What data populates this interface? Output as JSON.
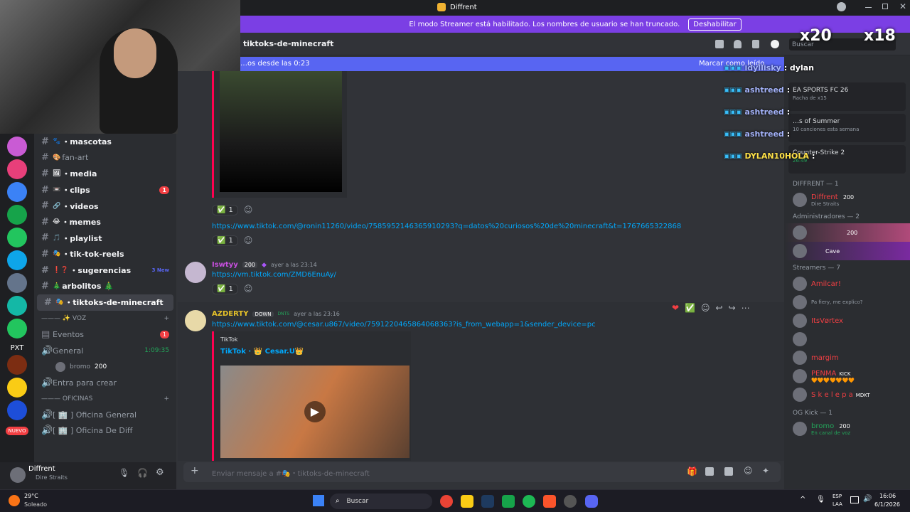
{
  "app": {
    "title": "Diffrent"
  },
  "banner": {
    "text": "El modo Streamer está habilitado. Los nombres de usuario se han truncado.",
    "button": "Deshabilitar"
  },
  "channel_header": {
    "name": "tiktoks-de-minecraft",
    "search_placeholder": "Buscar"
  },
  "new_bar": {
    "text": "…os desde las 0:23",
    "action": "Marcar como leído"
  },
  "channels": [
    {
      "emoji": "🐾",
      "name": "・mascotas",
      "unread": true
    },
    {
      "emoji": "🎨",
      "name": "fan-art",
      "unread": false
    },
    {
      "emoji": "🖼",
      "name": "・media",
      "unread": true
    },
    {
      "emoji": "📼",
      "name": "・clips",
      "unread": true,
      "badge": "1"
    },
    {
      "emoji": "🔗",
      "name": "・videos",
      "unread": true
    },
    {
      "emoji": "😂",
      "name": "・memes",
      "unread": true
    },
    {
      "emoji": "🎵",
      "name": "・playlist",
      "unread": true
    },
    {
      "emoji": "🎭",
      "name": "・tik-tok-reels",
      "unread": true
    },
    {
      "emoji": "❗❓",
      "name": "・sugerencias",
      "unread": true,
      "new": "3 New"
    },
    {
      "emoji": "🎄",
      "name": "arbolitos 🎄",
      "unread": true
    },
    {
      "emoji": "🎭",
      "name": "・tiktoks-de-minecraft",
      "unread": true,
      "active": true
    }
  ],
  "voice": {
    "category": "——— ✨ VOZ",
    "events": "Eventos",
    "events_badge": "1",
    "general": "General",
    "general_time": "1:09:35",
    "member": "bromo",
    "member_tag": "200",
    "create": "Entra para crear",
    "offices_category": "——— OFICINAS",
    "office1": "[ 🏢 ] Oficina General",
    "office2": "[ 🏢 ] Oficina De Diff"
  },
  "guild_badges": {
    "nuevo": "NUEVO",
    "pxt": "PXT"
  },
  "user": {
    "name": "Diffrent",
    "status": "Dire Straits"
  },
  "messages": {
    "reaction_count": "1",
    "link1": "https://www.tiktok.com/@ronin11260/video/7585952146365910293?q=datos%20curiosos%20de%20minecraft&t=1767665322868",
    "m2_author": "Iswtyy",
    "m2_tag": "200",
    "m2_time": "ayer a las 23:14",
    "m2_link": "https://vm.tiktok.com/ZMD6EnuAy/",
    "m3_author": "AZDERTY",
    "m3_tag1": "DOWN",
    "m3_tag2": "DNTS",
    "m3_time": "ayer a las 23:16",
    "m3_link": "https://www.tiktok.com/@cesar.u867/video/7591220465864068363?is_from_webapp=1&sender_device=pc",
    "embed_provider": "TikTok",
    "embed_title": "TikTok · 👑 Cesar.U👑"
  },
  "composer": {
    "placeholder": "Enviar mensaje a #🎭・tiktoks-de-minecraft"
  },
  "activities": [
    {
      "title": "EA SPORTS FC 26",
      "sub": "Racha de x15"
    },
    {
      "title": "…s of Summer",
      "sub": "10 canciones esta semana"
    },
    {
      "title": "Counter-Strike 2",
      "sub": "26:49"
    }
  ],
  "members": {
    "diffrent_header": "DIFFRENT — 1",
    "diffrent": {
      "name": "Diffrent",
      "tag": "200",
      "status": "Dire Straits"
    },
    "admins_header": "Administradores — 2",
    "admin1_tag": "200",
    "admin2_tag": "Cave",
    "streamers_header": "Streamers — 7",
    "streamers": [
      {
        "name": "Amilcar!",
        "color": "#f23f43"
      },
      {
        "name": "",
        "status": "Pa fiery, me explico?",
        "color": "#f23f43"
      },
      {
        "name": "ItsVørtex",
        "color": "#f23f43"
      },
      {
        "name": "",
        "color": "#f23f43"
      },
      {
        "name": "margim",
        "color": "#f23f43"
      },
      {
        "name": "PENMA",
        "tag": "KICK",
        "status": "🧡🧡🧡🧡🧡🧡🧡",
        "color": "#f23f43"
      },
      {
        "name": "S k e l e p a",
        "tag": "MDKT",
        "color": "#f23f43"
      }
    ],
    "og_header": "OG Kick — 1",
    "og": {
      "name": "bromo",
      "tag": "200",
      "status": "En canal de voz"
    }
  },
  "overlay": {
    "multipliers": [
      "x20",
      "x18"
    ],
    "chat": [
      {
        "user": "idyllisky",
        "msg": ": dylan"
      },
      {
        "user": "ashtreed",
        "msg": ":"
      },
      {
        "user": "ashtreed",
        "msg": ":"
      },
      {
        "user": "ashtreed",
        "msg": ":"
      },
      {
        "user": "DYLAN10HOLA",
        "msg": ":"
      }
    ]
  },
  "taskbar": {
    "weather_temp": "29°C",
    "weather_desc": "Soleado",
    "search": "Buscar",
    "lang1": "ESP",
    "lang2": "LAA",
    "time": "16:06",
    "date": "6/1/2026"
  }
}
